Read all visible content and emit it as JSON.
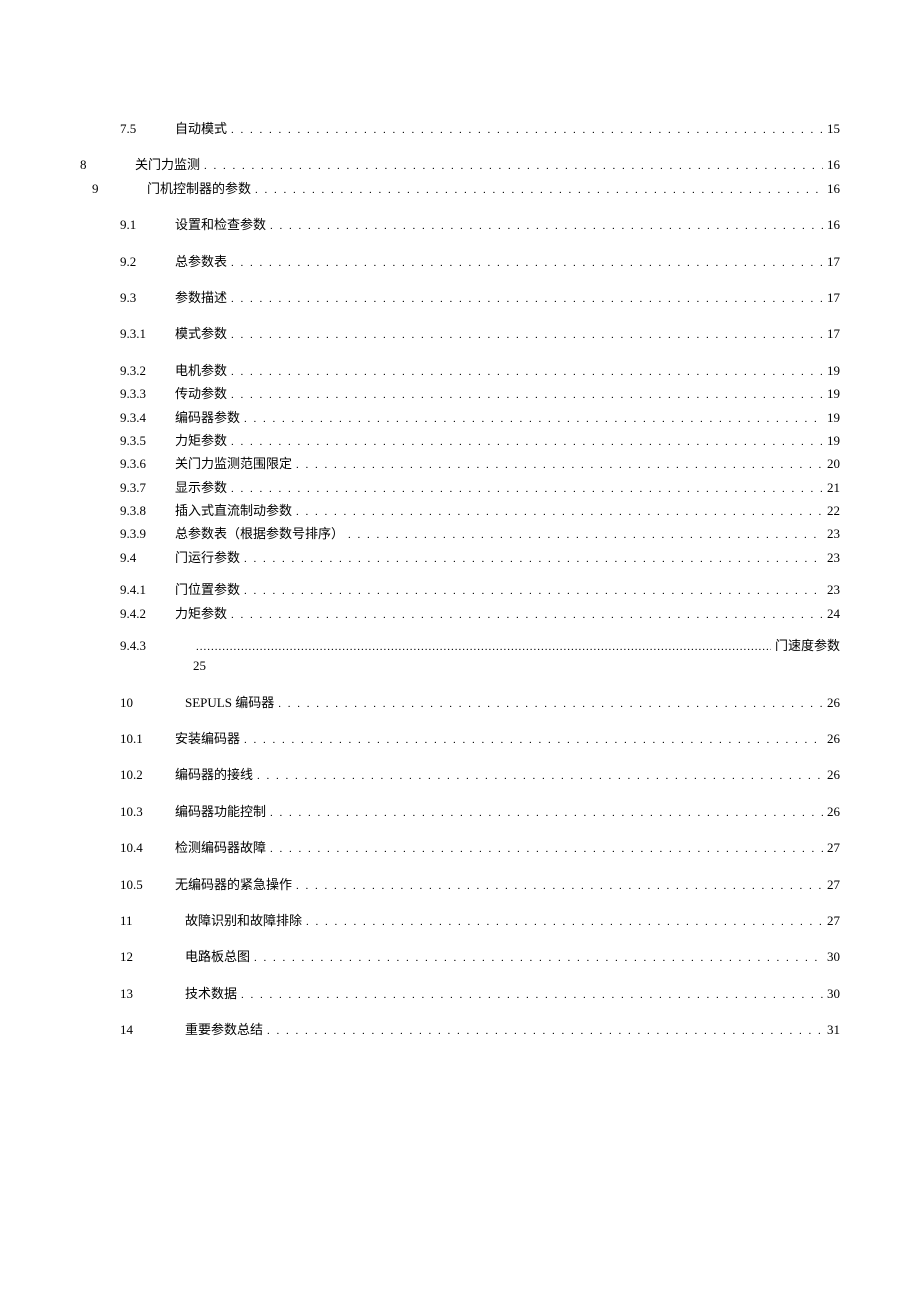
{
  "entries": [
    {
      "type": "sub",
      "indent": "ind-2",
      "numClass": "w-sub",
      "num": "7.5",
      "title": "自动模式",
      "page": "15",
      "spaced": "spaced-lg"
    },
    {
      "type": "main",
      "indent": "ind-0",
      "numClass": "w-main",
      "num": "8",
      "title": "关门力监测 ",
      "page": "16",
      "spaced": ""
    },
    {
      "type": "main",
      "indent": "ind-1",
      "numClass": "w-main",
      "num": "9",
      "title": "门机控制器的参数 ",
      "page": "16",
      "spaced": "spaced-lg"
    },
    {
      "type": "sub",
      "indent": "ind-2",
      "numClass": "w-sub",
      "num": "9.1",
      "title": "设置和检查参数",
      "page": "16",
      "spaced": "spaced-lg"
    },
    {
      "type": "sub",
      "indent": "ind-2",
      "numClass": "w-sub",
      "num": "9.2",
      "title": "总参数表",
      "page": "17",
      "spaced": "spaced-lg"
    },
    {
      "type": "sub",
      "indent": "ind-2",
      "numClass": "w-sub",
      "num": "9.3",
      "title": "参数描述",
      "page": "17",
      "spaced": "spaced-lg"
    },
    {
      "type": "sub2",
      "indent": "ind-3",
      "numClass": "w-sub2",
      "num": "9.3.1",
      "title": "模式参数",
      "page": "17",
      "spaced": "spaced-lg"
    },
    {
      "type": "sub2",
      "indent": "ind-3",
      "numClass": "w-sub2",
      "num": "9.3.2",
      "title": "电机参数 ",
      "page": "19",
      "spaced": ""
    },
    {
      "type": "sub2",
      "indent": "ind-3",
      "numClass": "w-sub2",
      "num": "9.3.3",
      "title": "传动参数 ",
      "page": "19",
      "spaced": ""
    },
    {
      "type": "sub2",
      "indent": "ind-3",
      "numClass": "w-sub2",
      "num": "9.3.4",
      "title": "编码器参数 ",
      "page": "19",
      "spaced": ""
    },
    {
      "type": "sub2",
      "indent": "ind-3",
      "numClass": "w-sub2",
      "num": "9.3.5",
      "title": "力矩参数 ",
      "page": "19",
      "spaced": ""
    },
    {
      "type": "sub2",
      "indent": "ind-3",
      "numClass": "w-sub2",
      "num": "9.3.6",
      "title": "关门力监测范围限定 ",
      "page": "20",
      "spaced": ""
    },
    {
      "type": "sub2",
      "indent": "ind-3",
      "numClass": "w-sub2",
      "num": "9.3.7",
      "title": "显示参数 ",
      "page": "21",
      "spaced": ""
    },
    {
      "type": "sub2",
      "indent": "ind-3",
      "numClass": "w-sub2",
      "num": "9.3.8",
      "title": "插入式直流制动参数 ",
      "page": "22",
      "spaced": ""
    },
    {
      "type": "sub2",
      "indent": "ind-3",
      "numClass": "w-sub2",
      "num": "9.3.9",
      "title": "总参数表（根据参数号排序） ",
      "page": "23",
      "spaced": ""
    },
    {
      "type": "sub",
      "indent": "ind-2",
      "numClass": "w-sub",
      "num": "9.4",
      "title": "门运行参数",
      "page": "23",
      "spaced": "spaced"
    },
    {
      "type": "sub2",
      "indent": "ind-3",
      "numClass": "w-sub2",
      "num": "9.4.1",
      "title": "   门位置参数",
      "page": "23",
      "spaced": ""
    },
    {
      "type": "sub2",
      "indent": "ind-3",
      "numClass": "w-sub2",
      "num": "9.4.2",
      "title": "   力矩参数",
      "page": "24",
      "spaced": "spaced"
    }
  ],
  "special_943": {
    "num": "9.4.3",
    "tail": "门速度参数",
    "sub": "25"
  },
  "entries2": [
    {
      "type": "sect",
      "indent": "ind-2",
      "numClass": "w-sect",
      "num": "10",
      "title": "SEPULS 编码器 ",
      "page": "26",
      "spaced": "spaced-lg"
    },
    {
      "type": "sub",
      "indent": "ind-2",
      "numClass": "w-sub",
      "num": "10.1",
      "title": "安装编码器",
      "page": "26",
      "spaced": "spaced-lg"
    },
    {
      "type": "sub",
      "indent": "ind-2",
      "numClass": "w-sub",
      "num": "10.2",
      "title": "编码器的接线",
      "page": "26",
      "spaced": "spaced-lg"
    },
    {
      "type": "sub",
      "indent": "ind-2",
      "numClass": "w-sub",
      "num": "10.3",
      "title": "编码器功能控制",
      "page": "26",
      "spaced": "spaced-lg"
    },
    {
      "type": "sub",
      "indent": "ind-2",
      "numClass": "w-sub",
      "num": "10.4",
      "title": "检测编码器故障",
      "page": "27",
      "spaced": "spaced-lg"
    },
    {
      "type": "sub",
      "indent": "ind-2",
      "numClass": "w-sub",
      "num": "10.5",
      "title": "无编码器的紧急操作",
      "page": "27",
      "spaced": "spaced-lg"
    },
    {
      "type": "sect",
      "indent": "ind-2",
      "numClass": "w-sect",
      "num": "11",
      "title": "故障识别和故障排除",
      "page": "27",
      "spaced": "spaced-lg"
    },
    {
      "type": "sect",
      "indent": "ind-2",
      "numClass": "w-sect",
      "num": "12",
      "title": "电路板总图",
      "page": "30",
      "spaced": "spaced-lg"
    },
    {
      "type": "sect",
      "indent": "ind-2",
      "numClass": "w-sect",
      "num": "13",
      "title": "技术数据",
      "page": "30",
      "spaced": "spaced-lg"
    },
    {
      "type": "sect",
      "indent": "ind-2",
      "numClass": "w-sect",
      "num": "14",
      "title": "重要参数总结",
      "page": "31",
      "spaced": "spaced-lg"
    }
  ]
}
